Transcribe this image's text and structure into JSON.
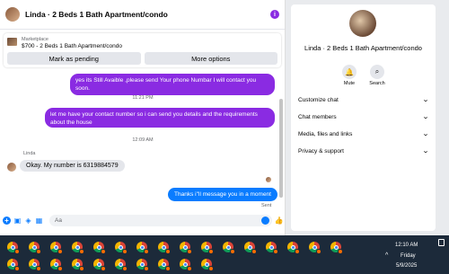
{
  "chat": {
    "title": "Linda · 2 Beds 1 Bath Apartment/condo",
    "listing": {
      "source": "Marketplace",
      "title": "$700 - 2 Beds 1 Bath Apartment/condo",
      "mark_pending_label": "Mark as pending",
      "more_options_label": "More options"
    },
    "messages": [
      {
        "type": "out",
        "text": "yes its Still Avaible ,please send Your phone Numbar I will contact you soon."
      },
      {
        "type": "time",
        "text": "11:21 PM"
      },
      {
        "type": "out",
        "text_lines": [
          "let me have your contact number so i can send you details and the requirements",
          "about the house"
        ]
      },
      {
        "type": "time",
        "text": "12:09 AM"
      },
      {
        "type": "sender",
        "text": "Linda"
      },
      {
        "type": "in",
        "text": "Okay. My number is 6319884579"
      },
      {
        "type": "out",
        "text": "Thanks i''ll message you in a moment"
      },
      {
        "type": "status",
        "text": "Sent"
      }
    ],
    "composer": {
      "placeholder": "Aa"
    }
  },
  "info_panel": {
    "title": "Linda · 2 Beds 1 Bath Apartment/condo",
    "actions": [
      {
        "label": "Mute",
        "icon": "bell-icon"
      },
      {
        "label": "Search",
        "icon": "search-icon"
      }
    ],
    "sections": [
      {
        "label": "Customize chat"
      },
      {
        "label": "Chat members"
      },
      {
        "label": "Media, files and links"
      },
      {
        "label": "Privacy & support"
      }
    ]
  },
  "taskbar": {
    "time": "12:10 AM",
    "day": "Friday",
    "date": "5/9/2025"
  },
  "colors": {
    "accent_purple": "#8a2be2",
    "accent_blue": "#0a7cff",
    "taskbar": "#1c2a3a"
  }
}
